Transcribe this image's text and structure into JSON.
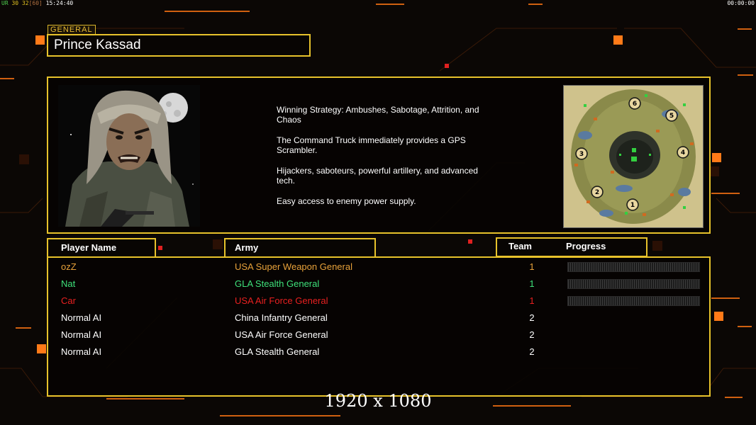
{
  "hud": {
    "fps_label": "UR",
    "fps_a": "30",
    "fps_b": "32",
    "fps_c": "[60]",
    "clock": "15:24:40",
    "timer": "00:00:00"
  },
  "general": {
    "tag": "GENERAL",
    "name": "Prince Kassad",
    "description": [
      "Winning Strategy: Ambushes, Sabotage, Attrition, and\n Chaos",
      "The Command Truck immediately provides a GPS\n Scrambler.",
      "Hijackers, saboteurs, powerful artillery, and advanced\n tech.",
      "Easy access to enemy power supply."
    ]
  },
  "map": {
    "start_positions": [
      "1",
      "2",
      "3",
      "4",
      "5",
      "6"
    ]
  },
  "table": {
    "headers": {
      "player": "Player Name",
      "army": "Army",
      "team": "Team",
      "progress": "Progress"
    },
    "rows": [
      {
        "name": "ozZ",
        "army": "USA Super Weapon General",
        "team": "1",
        "color": "#e7a13a",
        "progress": 0
      },
      {
        "name": "Nat",
        "army": "GLA Stealth General",
        "team": "1",
        "color": "#3ee07a",
        "progress": 0
      },
      {
        "name": "Car",
        "army": "USA Air Force General",
        "team": "1",
        "color": "#e82020",
        "progress": 0
      },
      {
        "name": "Normal AI",
        "army": "China Infantry General",
        "team": "2",
        "color": "#ffffff"
      },
      {
        "name": "Normal AI",
        "army": "USA Air Force General",
        "team": "2",
        "color": "#ffffff"
      },
      {
        "name": "Normal AI",
        "army": "GLA Stealth General",
        "team": "2",
        "color": "#ffffff"
      }
    ]
  },
  "resolution": "1920 x 1080",
  "colors": {
    "frame": "#e7c22b",
    "background": "#0b0705",
    "accent_orange": "#ff7a18"
  }
}
